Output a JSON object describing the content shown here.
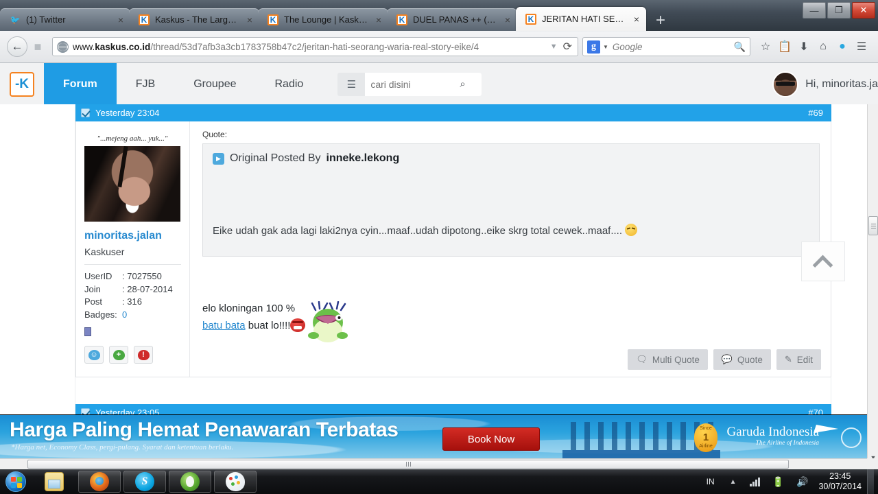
{
  "browser": {
    "tabs": [
      {
        "title": "(1) Twitter",
        "favicon": "twitter-icon",
        "active": false
      },
      {
        "title": "Kaskus - The Largest ...",
        "favicon": "kaskus-icon",
        "active": false
      },
      {
        "title": "The Lounge | Kaskus ...",
        "favicon": "kaskus-icon",
        "active": false
      },
      {
        "title": "DUEL PANAS ++ (PE...",
        "favicon": "kaskus-icon",
        "active": false
      },
      {
        "title": "JERITAN HATI SEOR...",
        "favicon": "kaskus-icon",
        "active": true
      }
    ],
    "new_tab_label": "+",
    "close_label": "×",
    "window_controls": {
      "minimize": "—",
      "restore": "❐",
      "close": "✕"
    },
    "url": {
      "scheme_host_prefix": "www.",
      "host": "kaskus.co.id",
      "path": "/thread/53d7afb3a3cb1783758b47c2/jeritan-hati-seorang-waria-real-story-eike/4",
      "dropdown": "▼",
      "reload": "⟳"
    },
    "search": {
      "engine": "Google",
      "engine_letter": "g",
      "placeholder": "Google",
      "caret": "▼"
    },
    "toolbar_icons": [
      "bookmark-star-icon",
      "reading-list-icon",
      "downloads-icon",
      "home-icon",
      "skype-icon",
      "menu-icon"
    ],
    "nav_back": "←",
    "nav_forward": "→"
  },
  "site": {
    "logo_text": "-K",
    "nav": [
      {
        "label": "Forum",
        "active": true
      },
      {
        "label": "FJB",
        "active": false
      },
      {
        "label": "Groupee",
        "active": false
      },
      {
        "label": "Radio",
        "active": false
      }
    ],
    "search_placeholder": "cari disini",
    "search_value": "",
    "list_icon": "☰",
    "search_icon": "⌕",
    "greeting": "Hi, minoritas.ja"
  },
  "posts": [
    {
      "timestamp": "Yesterday 23:04",
      "number": "#69",
      "author": {
        "avatar_caption": "\"...mejeng aah... yuk...\"",
        "username": "minoritas.jalan",
        "rank": "Kaskuser",
        "stats": [
          {
            "key": "UserID",
            "sep": ":",
            "value": "7027550",
            "link": false
          },
          {
            "key": "Join",
            "sep": ":",
            "value": "28-07-2014",
            "link": false
          },
          {
            "key": "Post",
            "sep": ":",
            "value": "316",
            "link": false
          },
          {
            "key": "Badges:",
            "sep": "",
            "value": "0",
            "link": true
          }
        ],
        "action_icons": [
          "profile-bubble-icon",
          "add-bubble-icon",
          "report-bubble-icon"
        ]
      },
      "quote": {
        "label": "Quote:",
        "header_prefix": "Original Posted By",
        "header_author": "inneke.lekong",
        "body": "Eike udah gak ada lagi laki2nya cyin...maaf..udah dipotong..eike skrg total cewek..maaf....",
        "emoticon": "wink-smiley-icon"
      },
      "body_line1": "elo kloningan 100 %",
      "body_link": "batu bata",
      "body_line2_tail": " buat lo!!!!",
      "body_emoticon": "angry-face-icon",
      "body_sticker": "frog-sticker-icon",
      "actions": [
        {
          "label": "Multi Quote",
          "icon": "multi-quote-icon"
        },
        {
          "label": "Quote",
          "icon": "quote-icon"
        },
        {
          "label": "Edit",
          "icon": "edit-icon"
        }
      ]
    },
    {
      "timestamp": "Yesterday 23:05",
      "number": "#70"
    }
  ],
  "scroll_top_button": {
    "icon": "chevron-up-icon"
  },
  "ad": {
    "title": "Harga Paling Hemat Penawaran Terbatas",
    "subtitle": "*Harga net, Economy Class, pergi-pulang. Syarat dan ketentuan berlaku.",
    "cta": "Book Now",
    "badge_top": "Since",
    "badge_number": "1",
    "badge_bottom": "Airline",
    "brand": "Garuda Indonesia",
    "brand_tagline": "The Airline of Indonesia"
  },
  "taskbar": {
    "start_label": "start-orb-icon",
    "buttons": [
      {
        "name": "explorer-taskbar-button",
        "icon": "folder-icon",
        "open": false
      },
      {
        "name": "firefox-taskbar-button",
        "icon": "firefox-icon",
        "open": true
      },
      {
        "name": "skype-taskbar-button",
        "icon": "skype-icon",
        "open": true
      },
      {
        "name": "opera-taskbar-button",
        "icon": "opera-icon",
        "open": true
      },
      {
        "name": "paint-taskbar-button",
        "icon": "paint-icon",
        "open": true
      }
    ],
    "tray": {
      "language": "IN",
      "caret": "▲",
      "network_icon": "signal-bars-icon",
      "battery_icon": "battery-charging-icon",
      "volume_icon": "volume-icon",
      "time": "23:45",
      "date": "30/07/2014"
    }
  }
}
